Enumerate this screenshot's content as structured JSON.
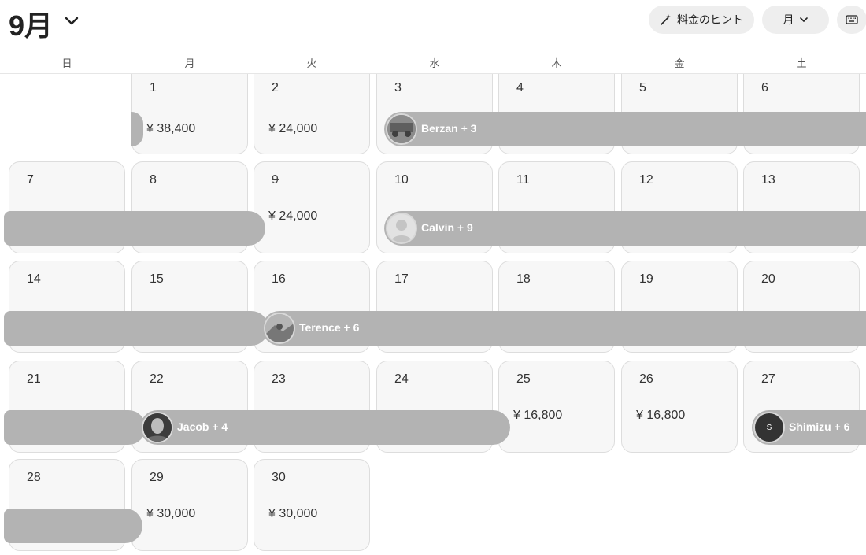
{
  "header": {
    "month_title": "9月",
    "hint_label": "料金のヒント",
    "view_label": "月"
  },
  "weekdays": [
    "日",
    "月",
    "火",
    "水",
    "木",
    "金",
    "土"
  ],
  "days": [
    {
      "num": "1",
      "price": "¥ 38,400"
    },
    {
      "num": "2",
      "price": "¥ 24,000"
    },
    {
      "num": "3",
      "price": ""
    },
    {
      "num": "4",
      "price": ""
    },
    {
      "num": "5",
      "price": ""
    },
    {
      "num": "6",
      "price": ""
    },
    {
      "num": "7",
      "price": ""
    },
    {
      "num": "8",
      "price": ""
    },
    {
      "num": "9",
      "price": "¥ 24,000",
      "unavailable": true
    },
    {
      "num": "10",
      "price": ""
    },
    {
      "num": "11",
      "price": ""
    },
    {
      "num": "12",
      "price": ""
    },
    {
      "num": "13",
      "price": ""
    },
    {
      "num": "14",
      "price": ""
    },
    {
      "num": "15",
      "price": ""
    },
    {
      "num": "16",
      "price": ""
    },
    {
      "num": "17",
      "price": ""
    },
    {
      "num": "18",
      "price": ""
    },
    {
      "num": "19",
      "price": ""
    },
    {
      "num": "20",
      "price": ""
    },
    {
      "num": "21",
      "price": ""
    },
    {
      "num": "22",
      "price": ""
    },
    {
      "num": "23",
      "price": ""
    },
    {
      "num": "24",
      "price": ""
    },
    {
      "num": "25",
      "price": "¥ 16,800"
    },
    {
      "num": "26",
      "price": "¥ 16,800"
    },
    {
      "num": "27",
      "price": ""
    },
    {
      "num": "28",
      "price": ""
    },
    {
      "num": "29",
      "price": "¥ 30,000"
    },
    {
      "num": "30",
      "price": "¥ 30,000"
    }
  ],
  "reservations": {
    "berzan": "Berzan + 3",
    "calvin": "Calvin + 9",
    "terence": "Terence + 6",
    "jacob": "Jacob + 4",
    "shimizu": "Shimizu + 6",
    "shimizu_initial": "S"
  }
}
